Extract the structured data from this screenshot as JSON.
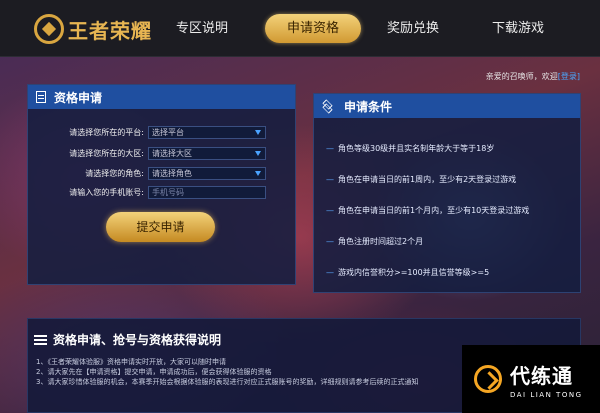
{
  "nav": {
    "logo_text": "王者荣耀",
    "items": [
      {
        "label": "专区说明",
        "active": false
      },
      {
        "label": "申请资格",
        "active": true
      },
      {
        "label": "奖励兑换",
        "active": false
      },
      {
        "label": "下载游戏",
        "active": false
      }
    ]
  },
  "welcome": {
    "text": "亲爱的召唤师，欢迎",
    "login": "[登录]"
  },
  "apply": {
    "title": "资格申请",
    "fields": [
      {
        "label": "请选择您所在的平台:",
        "value": "选择平台",
        "type": "select"
      },
      {
        "label": "请选择您所在的大区:",
        "value": "请选择大区",
        "type": "select"
      },
      {
        "label": "请选择您的角色:",
        "value": "请选择角色",
        "type": "select"
      },
      {
        "label": "请输入您的手机账号:",
        "placeholder": "手机号码",
        "type": "input"
      }
    ],
    "submit_label": "提交申请"
  },
  "conditions": {
    "title": "申请条件",
    "items": [
      "角色等级30级并且实名制年龄大于等于18岁",
      "角色在申请当日的前1周内，至少有2天登录过游戏",
      "角色在申请当日的前1个月内，至少有10天登录过游戏",
      "角色注册时间超过2个月",
      "游戏内信誉积分>=100并且信誉等级>=5"
    ]
  },
  "explain": {
    "title": "资格申请、抢号与资格获得说明",
    "lines": [
      "1、《王者荣耀体验服》资格申请实时开放，大家可以随时申请",
      "2、请大家先在【申请资格】提交申请，申请成功后，便会获得体验服的资格",
      "3、请大家珍惜体验服的机会，本赛季开始会根据体验服的表现进行对应正式服账号的奖励，详细规则请参考后续的正式通知"
    ]
  },
  "watermark": {
    "cn": "代练通",
    "en": "DAI LIAN TONG"
  },
  "colors": {
    "accent_gold": "#d19932",
    "panel_head_blue": "#1f4fa0",
    "link_blue": "#4aa8ff"
  }
}
